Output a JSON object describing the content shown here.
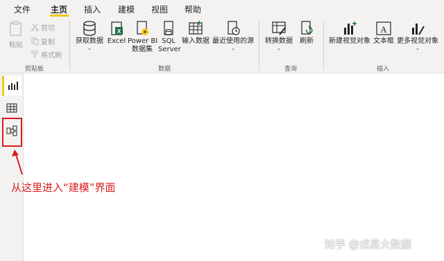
{
  "menu": {
    "file": "文件",
    "home": "主页",
    "insert": "插入",
    "modeling": "建模",
    "view": "视图",
    "help": "帮助"
  },
  "ribbon": {
    "clipboard": {
      "paste": "粘贴",
      "cut": "剪切",
      "copy": "复制",
      "format_painter": "格式刷",
      "group_label": "剪贴板"
    },
    "data": {
      "get_data": "获取数据",
      "excel": "Excel",
      "powerbi_line1": "Power BI",
      "powerbi_line2": "数据集",
      "sql_line1": "SQL",
      "sql_line2": "Server",
      "enter_data": "输入数据",
      "recent_sources": "最近使用的源",
      "group_label": "数据"
    },
    "query": {
      "transform": "转换数据",
      "refresh": "刷新",
      "group_label": "查询"
    },
    "insert": {
      "new_visual": "新建视觉对象",
      "text_box": "文本框",
      "more_visuals": "更多视觉对象",
      "group_label": "插入"
    }
  },
  "annotation": "从这里进入“建模”界面",
  "watermark": "知乎 @戎易大数据",
  "colors": {
    "accent": "#f2c811",
    "highlight": "#d81e1e"
  }
}
